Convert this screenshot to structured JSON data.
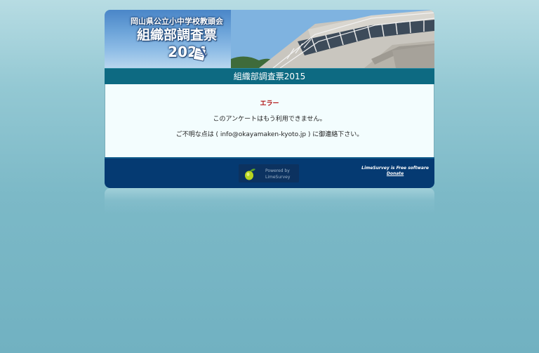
{
  "header": {
    "org_name": "岡山県公立小中学校教頭会",
    "survey_name": "組織部調査票",
    "year": "2024"
  },
  "title_bar": {
    "title": "組織部調査票2015"
  },
  "content": {
    "error_label": "エラー",
    "message": "このアンケートはもう利用できません。",
    "contact": "ご不明な点は ( info@okayamaken-kyoto.jp ) に御連絡下さい。"
  },
  "footer": {
    "powered_line1": "Powered by",
    "powered_line2": "LimeSurvey",
    "free_text": "LimeSurvey is Free software",
    "donate_text": "Donate"
  },
  "colors": {
    "title_bar": "#0d6a82",
    "footer": "#053a72",
    "error": "#b01010",
    "content_bg": "#f3fdfe"
  }
}
